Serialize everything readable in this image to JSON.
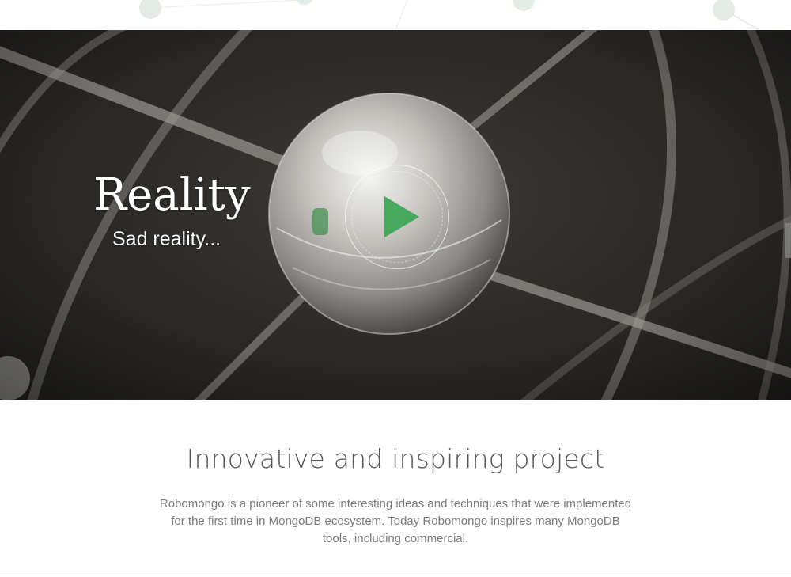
{
  "hero": {
    "title": "Reality",
    "subtitle": "Sad reality...",
    "play_icon": "play-icon",
    "accent_color": "#3aa655"
  },
  "section": {
    "title": "Innovative and inspiring project",
    "body": "Robomongo is a pioneer of some interesting ideas and techniques that were implemented for the first time in MongoDB ecosystem. Today Robomongo inspires many MongoDB tools, including commercial."
  },
  "colors": {
    "hero_background": "#2b2927",
    "text_muted": "#7a7a7a",
    "title_text": "#555555"
  }
}
